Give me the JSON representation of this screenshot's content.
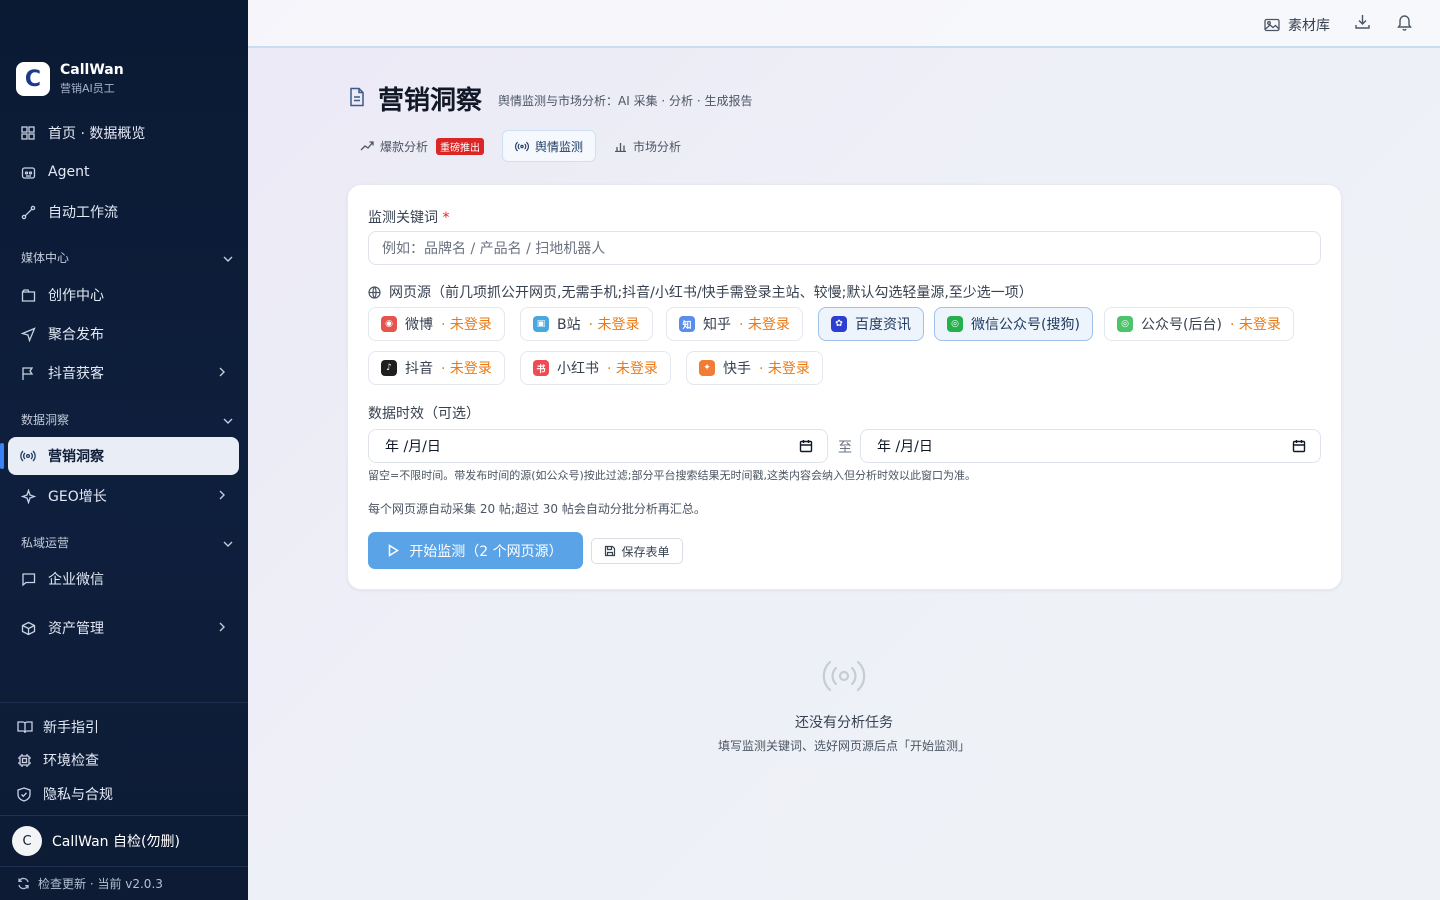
{
  "brand": {
    "name": "CallWan",
    "subtitle": "营销AI员工",
    "logo_letter": "C"
  },
  "sidebar": {
    "items": [
      {
        "label": "首页 · 数据概览",
        "icon": "grid-icon"
      },
      {
        "label": "Agent",
        "icon": "bot-icon"
      },
      {
        "label": "自动工作流",
        "icon": "workflow-icon"
      }
    ],
    "sections": [
      {
        "title": "媒体中心",
        "items": [
          {
            "label": "创作中心",
            "icon": "folder-icon"
          },
          {
            "label": "聚合发布",
            "icon": "send-icon"
          },
          {
            "label": "抖音获客",
            "icon": "flag-icon"
          }
        ]
      },
      {
        "title": "数据洞察",
        "items": [
          {
            "label": "营销洞察",
            "icon": "radio-icon",
            "active": true
          },
          {
            "label": "GEO增长",
            "icon": "sparkle-icon"
          }
        ]
      },
      {
        "title": "私域运营",
        "items": [
          {
            "label": "企业微信",
            "icon": "chat-icon"
          }
        ]
      }
    ],
    "asset": {
      "label": "资产管理",
      "icon": "box-icon"
    },
    "footer": [
      {
        "label": "新手指引",
        "icon": "book-icon"
      },
      {
        "label": "环境检查",
        "icon": "cpu-icon"
      },
      {
        "label": "隐私与合规",
        "icon": "shield-icon"
      }
    ],
    "user": {
      "avatar": "C",
      "name": "CallWan 自检(勿删)"
    },
    "version": "检查更新 · 当前 v2.0.3"
  },
  "topbar": {
    "library": "素材库"
  },
  "page": {
    "title": "营销洞察",
    "subtitle": "舆情监测与市场分析：AI 采集 · 分析 · 生成报告",
    "tabs": [
      {
        "label": "爆款分析",
        "badge": "重磅推出"
      },
      {
        "label": "舆情监测",
        "active": true
      },
      {
        "label": "市场分析"
      }
    ]
  },
  "form": {
    "keyword_label": "监测关键词",
    "keyword_required": "*",
    "keyword_placeholder": "例如：品牌名 / 产品名 / 扫地机器人",
    "sources_label": "网页源（前几项抓公开网页,无需手机;抖音/小红书/快手需登录主站、较慢;默认勾选轻量源,至少选一项）",
    "sources": [
      {
        "label": "微博",
        "status": "· 未登录",
        "color": "#e5534b",
        "glyph": "◉"
      },
      {
        "label": "B站",
        "status": "· 未登录",
        "color": "#4aa8e0",
        "glyph": "▣"
      },
      {
        "label": "知乎",
        "status": "· 未登录",
        "color": "#5b8def",
        "glyph": "知"
      },
      {
        "label": "百度资讯",
        "status": "",
        "color": "#2d3fd0",
        "glyph": "✿",
        "selected": true
      },
      {
        "label": "微信公众号(搜狗)",
        "status": "",
        "color": "#22b14c",
        "glyph": "◎",
        "selected": true
      },
      {
        "label": "公众号(后台)",
        "status": "· 未登录",
        "color": "#4cc46a",
        "glyph": "◎"
      },
      {
        "label": "抖音",
        "status": "· 未登录",
        "color": "#1f1f1f",
        "glyph": "♪"
      },
      {
        "label": "小红书",
        "status": "· 未登录",
        "color": "#ef4b55",
        "glyph": "书"
      },
      {
        "label": "快手",
        "status": "· 未登录",
        "color": "#f27b35",
        "glyph": "✦"
      }
    ],
    "date_label": "数据时效（可选）",
    "date_from": "年 /月/日",
    "date_sep": "至",
    "date_to": "年 /月/日",
    "hint1": "留空=不限时间。带发布时间的源(如公众号)按此过滤;部分平台搜索结果无时间戳,这类内容会纳入但分析时效以此窗口为准。",
    "hint2": "每个网页源自动采集 20 帖;超过 30 帖会自动分批分析再汇总。",
    "start_button": "开始监测（2 个网页源）",
    "save_button": "保存表单"
  },
  "empty": {
    "title": "还没有分析任务",
    "subtitle": "填写监测关键词、选好网页源后点「开始监测」"
  }
}
